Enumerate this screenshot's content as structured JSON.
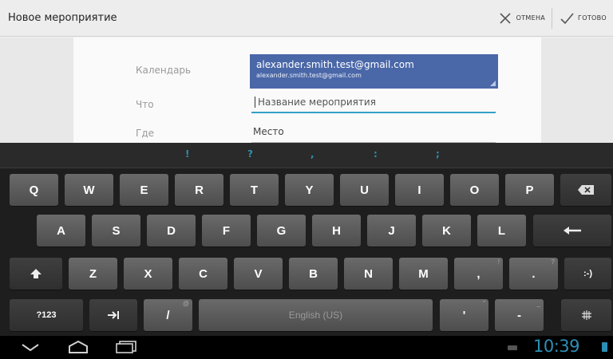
{
  "actionbar": {
    "title": "Новое мероприятие",
    "cancel_label": "ОТМЕНА",
    "done_label": "ГОТОВО"
  },
  "form": {
    "calendar_label": "Календарь",
    "calendar_account": "alexander.smith.test@gmail.com",
    "calendar_account_sub": "alexander.smith.test@gmail.com",
    "what_label": "Что",
    "what_placeholder": "Название мероприятия",
    "where_label": "Где",
    "where_placeholder": "Место"
  },
  "keyboard": {
    "suggestions": [
      "!",
      "?",
      ",",
      ":",
      ";"
    ],
    "row1": [
      "Q",
      "W",
      "E",
      "R",
      "T",
      "Y",
      "U",
      "I",
      "O",
      "P"
    ],
    "row2": [
      "A",
      "S",
      "D",
      "F",
      "G",
      "H",
      "J",
      "K",
      "L"
    ],
    "row3": [
      "Z",
      "X",
      "C",
      "V",
      "B",
      "N",
      "M"
    ],
    "comma": ",",
    "comma_hint": "!",
    "period": ".",
    "period_hint": "?",
    "smiley": ":-)",
    "symbols": "?123",
    "slash": "/",
    "slash_hint": "@",
    "space_label": "English (US)",
    "apostrophe": "'",
    "apostrophe_hint": "\"",
    "dash": "-",
    "dash_hint": "_"
  },
  "navbar": {
    "clock": "10:39"
  },
  "colors": {
    "accent": "#33a0c8",
    "calendar": "#4a67a8",
    "clock": "#2c8fb5"
  }
}
